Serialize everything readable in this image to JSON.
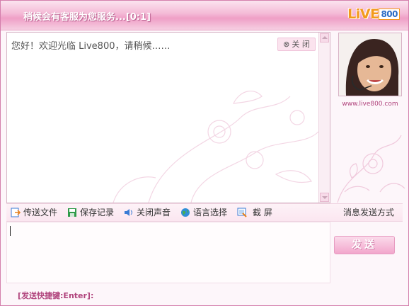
{
  "window": {
    "title": "稍候会有客服为您服务...[0:1]",
    "logo_text": "LiVE",
    "logo_num": "800"
  },
  "chat": {
    "welcome": "您好！欢迎光临 Live800，请稍候……",
    "close_label": "关 闭",
    "close_icon": "circle-x"
  },
  "sidebar": {
    "site_link": "www.live800.com"
  },
  "toolbar": {
    "items": [
      {
        "label": "传送文件",
        "icon": "send-file-icon"
      },
      {
        "label": "保存记录",
        "icon": "save-record-icon"
      },
      {
        "label": "关闭声音",
        "icon": "sound-icon"
      },
      {
        "label": "语言选择",
        "icon": "globe-icon"
      },
      {
        "label": "截 屏",
        "icon": "screenshot-icon"
      }
    ],
    "send_mode": "消息发送方式"
  },
  "input": {
    "send_label": "发送",
    "shortcut_hint": "[发送快捷键:Enter]:"
  },
  "colors": {
    "accent": "#ef9fc6",
    "link": "#b0437c",
    "logo": "#f39a1c"
  }
}
